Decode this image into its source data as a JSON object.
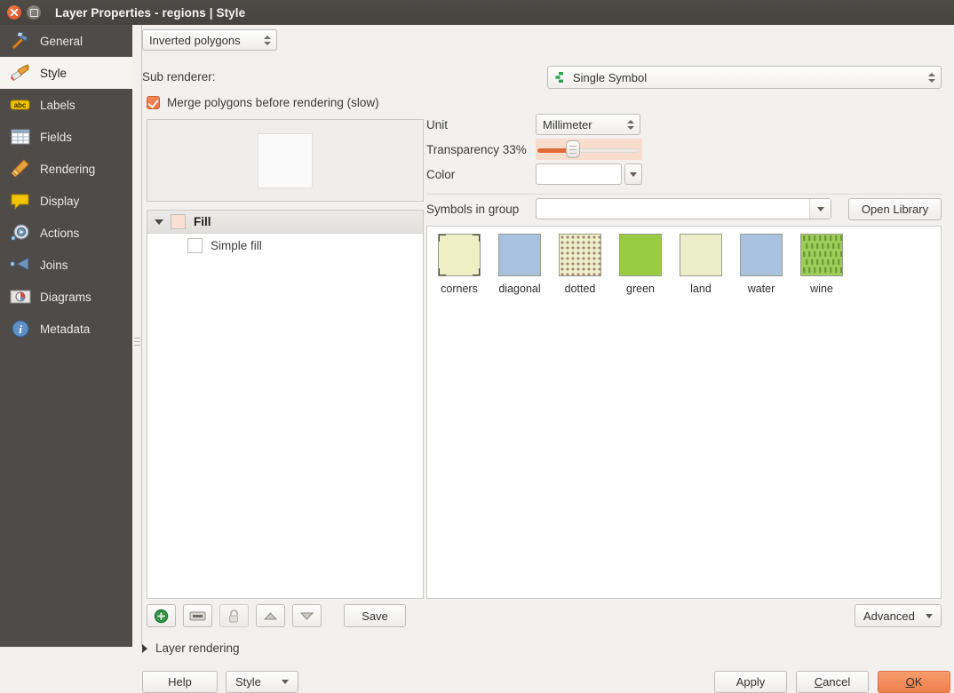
{
  "window": {
    "title": "Layer Properties - regions | Style",
    "close_icon": "close-icon",
    "maximize_icon": "maximize-icon"
  },
  "sidebar": {
    "items": [
      {
        "label": "General",
        "icon": "hammer-icon",
        "active": false
      },
      {
        "label": "Style",
        "icon": "brush-icon",
        "active": true
      },
      {
        "label": "Labels",
        "icon": "abc-label-icon",
        "active": false
      },
      {
        "label": "Fields",
        "icon": "table-icon",
        "active": false
      },
      {
        "label": "Rendering",
        "icon": "broom-icon",
        "active": false
      },
      {
        "label": "Display",
        "icon": "speech-bubble-icon",
        "active": false
      },
      {
        "label": "Actions",
        "icon": "gear-play-icon",
        "active": false
      },
      {
        "label": "Joins",
        "icon": "join-arrow-icon",
        "active": false
      },
      {
        "label": "Diagrams",
        "icon": "pie-chart-icon",
        "active": false
      },
      {
        "label": "Metadata",
        "icon": "info-icon",
        "active": false
      }
    ]
  },
  "style_panel": {
    "renderer_combo_value": "Inverted polygons",
    "sub_renderer_label": "Sub renderer:",
    "symbol_type_value": "Single Symbol",
    "symbol_type_icon": "single-symbol-icon",
    "merge_polygons_label": "Merge polygons before rendering (slow)",
    "merge_polygons_checked": true,
    "unit_label": "Unit",
    "unit_value": "Millimeter",
    "transparency_label": "Transparency 33%",
    "transparency_value": 33,
    "color_label": "Color",
    "color_value": "#ffffff",
    "symbols_group_label": "Symbols in group",
    "symbols_group_value": "",
    "open_library_label": "Open Library",
    "advanced_label": "Advanced",
    "save_label": "Save",
    "layer_tree": {
      "root_label": "Fill",
      "root_swatch": "#fadfd3",
      "child_label": "Simple fill",
      "child_swatch": "#ffffff"
    },
    "symbol_buttons": [
      {
        "name": "add-symbol-layer-button",
        "icon": "plus-icon",
        "enabled": true
      },
      {
        "name": "remove-symbol-layer-button",
        "icon": "minus-icon",
        "enabled": true
      },
      {
        "name": "lock-layer-button",
        "icon": "lock-icon",
        "enabled": false
      },
      {
        "name": "move-up-button",
        "icon": "arrow-up-icon",
        "enabled": true
      },
      {
        "name": "move-down-button",
        "icon": "arrow-down-icon",
        "enabled": true
      }
    ],
    "symbols": [
      {
        "name": "corners",
        "pattern": "corners",
        "base_color": "#eeefc5"
      },
      {
        "name": "diagonal",
        "pattern": "solid",
        "base_color": "#a7c1de"
      },
      {
        "name": "dotted",
        "pattern": "dotted",
        "base_color": "#eeeec8"
      },
      {
        "name": "green",
        "pattern": "solid",
        "base_color": "#9acc42"
      },
      {
        "name": "land",
        "pattern": "solid",
        "base_color": "#ebeec8"
      },
      {
        "name": "water",
        "pattern": "solid",
        "base_color": "#a7c1de"
      },
      {
        "name": "wine",
        "pattern": "dashes",
        "base_color": "#9ccc5a"
      }
    ]
  },
  "footer": {
    "layer_rendering_label": "Layer rendering",
    "help_label": "Help",
    "style_label": "Style",
    "apply_label": "Apply",
    "cancel_label": "Cancel",
    "ok_label": "OK"
  },
  "colors": {
    "accent_orange": "#ef7f4d",
    "titlebar": "#4e4a47",
    "sidebar": "#4f4b48",
    "window_bg": "#f2f1f0"
  }
}
